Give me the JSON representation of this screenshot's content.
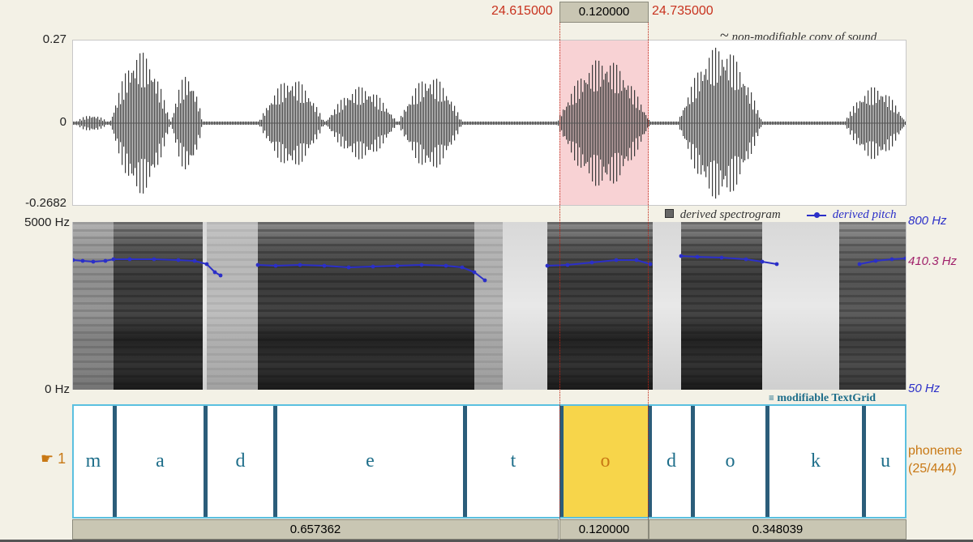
{
  "selection": {
    "start": "24.615000",
    "end": "24.735000",
    "duration": "0.120000"
  },
  "waveform": {
    "y_max": "0.27",
    "y_zero": "0",
    "y_min": "-0.2682",
    "title_symbol": "~",
    "title": "non-modifiable copy of sound"
  },
  "spectrogram": {
    "freq_max": "5000 Hz",
    "freq_min": "0 Hz",
    "legend_spectrogram": "derived spectrogram",
    "legend_pitch": "derived pitch",
    "pitch_max": "800 Hz",
    "pitch_current": "410.3 Hz",
    "pitch_min": "50 Hz"
  },
  "textgrid": {
    "title": "modifiable TextGrid",
    "tier_pointer_icon": "pointing-hand-icon",
    "tier_number": "1",
    "tier_name": "phoneme",
    "tier_count": "(25/444)",
    "intervals": [
      "m",
      "a",
      "d",
      "e",
      "t",
      "o",
      "d",
      "o",
      "k",
      "u"
    ],
    "selected_interval_color": "#f7d54a"
  },
  "bottom_bar": {
    "left": "0.657362",
    "mid": "0.120000",
    "right": "0.348039"
  },
  "colors": {
    "selection_start_end": "#c8321e",
    "pitch": "#2b2fc8",
    "pitch_current": "#a0206a",
    "tier_name": "#c87814",
    "textgrid_border": "#5bc0e0",
    "boundary": "#2b5d7a"
  }
}
